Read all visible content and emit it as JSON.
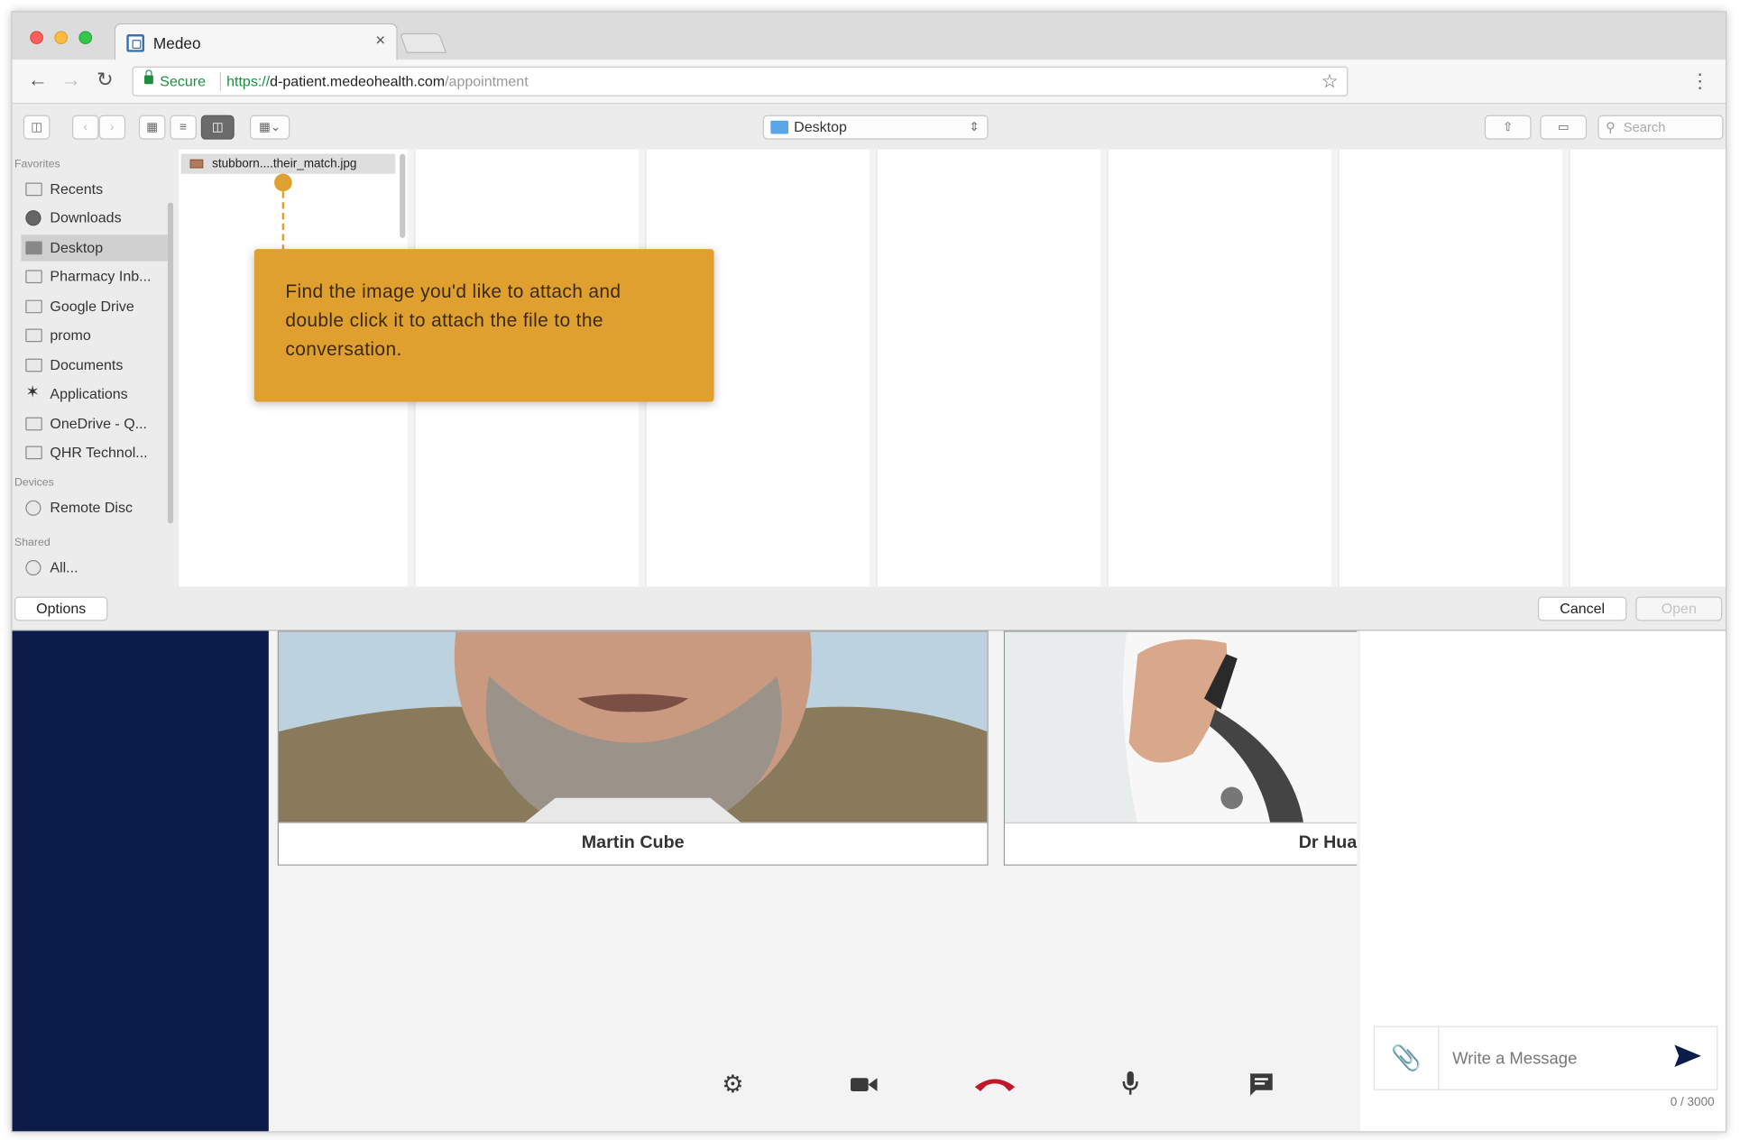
{
  "browser": {
    "tab_title": "Medeo",
    "tab_close": "×",
    "secure_label": "Secure",
    "url_scheme": "https://",
    "url_host": "d-patient.medeohealth.com",
    "url_path": "/appointment"
  },
  "finder": {
    "location": "Desktop",
    "search_placeholder": "Search",
    "sidebar": {
      "favorites_label": "Favorites",
      "favorites": [
        {
          "label": "Recents",
          "icon": "recents-icon"
        },
        {
          "label": "Downloads",
          "icon": "downloads-icon"
        },
        {
          "label": "Desktop",
          "icon": "desktop-icon",
          "selected": true
        },
        {
          "label": "Pharmacy Inb...",
          "icon": "folder-icon"
        },
        {
          "label": "Google Drive",
          "icon": "folder-icon"
        },
        {
          "label": "promo",
          "icon": "folder-icon"
        },
        {
          "label": "Documents",
          "icon": "documents-icon"
        },
        {
          "label": "Applications",
          "icon": "applications-icon"
        },
        {
          "label": "OneDrive - Q...",
          "icon": "folder-icon"
        },
        {
          "label": "QHR Technol...",
          "icon": "folder-icon"
        }
      ],
      "devices_label": "Devices",
      "devices": [
        {
          "label": "Remote Disc",
          "icon": "disc-icon"
        }
      ],
      "shared_label": "Shared",
      "shared": [
        {
          "label": "All...",
          "icon": "network-icon"
        }
      ]
    },
    "file_name": "stubborn....their_match.jpg",
    "options_label": "Options",
    "cancel_label": "Cancel",
    "open_label": "Open"
  },
  "callout": {
    "text": "Find the image you'd like to attach and double click it to attach the file to the conversation."
  },
  "call": {
    "patient_name": "Martin Cube",
    "doctor_name": "Dr Hua"
  },
  "chat": {
    "placeholder": "Write a Message",
    "char_count": "0 / 3000"
  },
  "colors": {
    "callout": "#e0a030",
    "app_sidebar": "#0b1c4b",
    "hangup": "#c0182a",
    "secure_green": "#1e8e3e"
  }
}
